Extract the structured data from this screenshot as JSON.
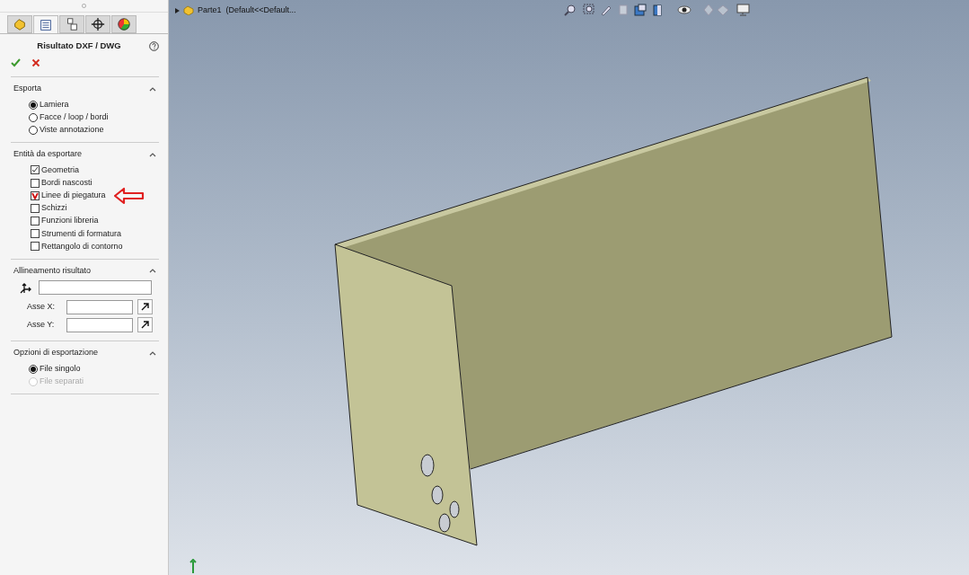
{
  "panel": {
    "tabs": [
      {
        "selected": false
      },
      {
        "selected": true
      },
      {
        "selected": false
      },
      {
        "selected": false
      },
      {
        "selected": false
      }
    ],
    "title": "Risultato DXF / DWG",
    "sections": [
      {
        "kind": "radio",
        "title": "Esporta",
        "expanded": true,
        "items": [
          {
            "label": "Lamiera",
            "selected": true,
            "disabled": false
          },
          {
            "label": "Facce / loop / bordi",
            "selected": false,
            "disabled": false
          },
          {
            "label": "Viste annotazione",
            "selected": false,
            "disabled": false
          }
        ]
      },
      {
        "kind": "check",
        "title": "Entità da esportare",
        "expanded": true,
        "items": [
          {
            "label": "Geometria",
            "checked": true
          },
          {
            "label": "Bordi nascosti",
            "checked": false
          },
          {
            "label": "Linee di piegatura",
            "checked": true,
            "highlighted": true
          },
          {
            "label": "Schizzi",
            "checked": false
          },
          {
            "label": "Funzioni libreria",
            "checked": false
          },
          {
            "label": "Strumenti di formatura",
            "checked": false
          },
          {
            "label": "Rettangolo di contorno",
            "checked": false
          }
        ]
      },
      {
        "kind": "align",
        "title": "Allineamento risultato",
        "expanded": true,
        "fields": [
          {
            "label": "Asse X:"
          },
          {
            "label": "Asse Y:"
          }
        ]
      },
      {
        "kind": "radio",
        "title": "Opzioni di esportazione",
        "expanded": true,
        "items": [
          {
            "label": "File singolo",
            "selected": true,
            "disabled": false
          },
          {
            "label": "File separati",
            "selected": false,
            "disabled": true
          }
        ]
      }
    ]
  },
  "viewport": {
    "tree_item": "Parte1  (Default<<Default..."
  }
}
